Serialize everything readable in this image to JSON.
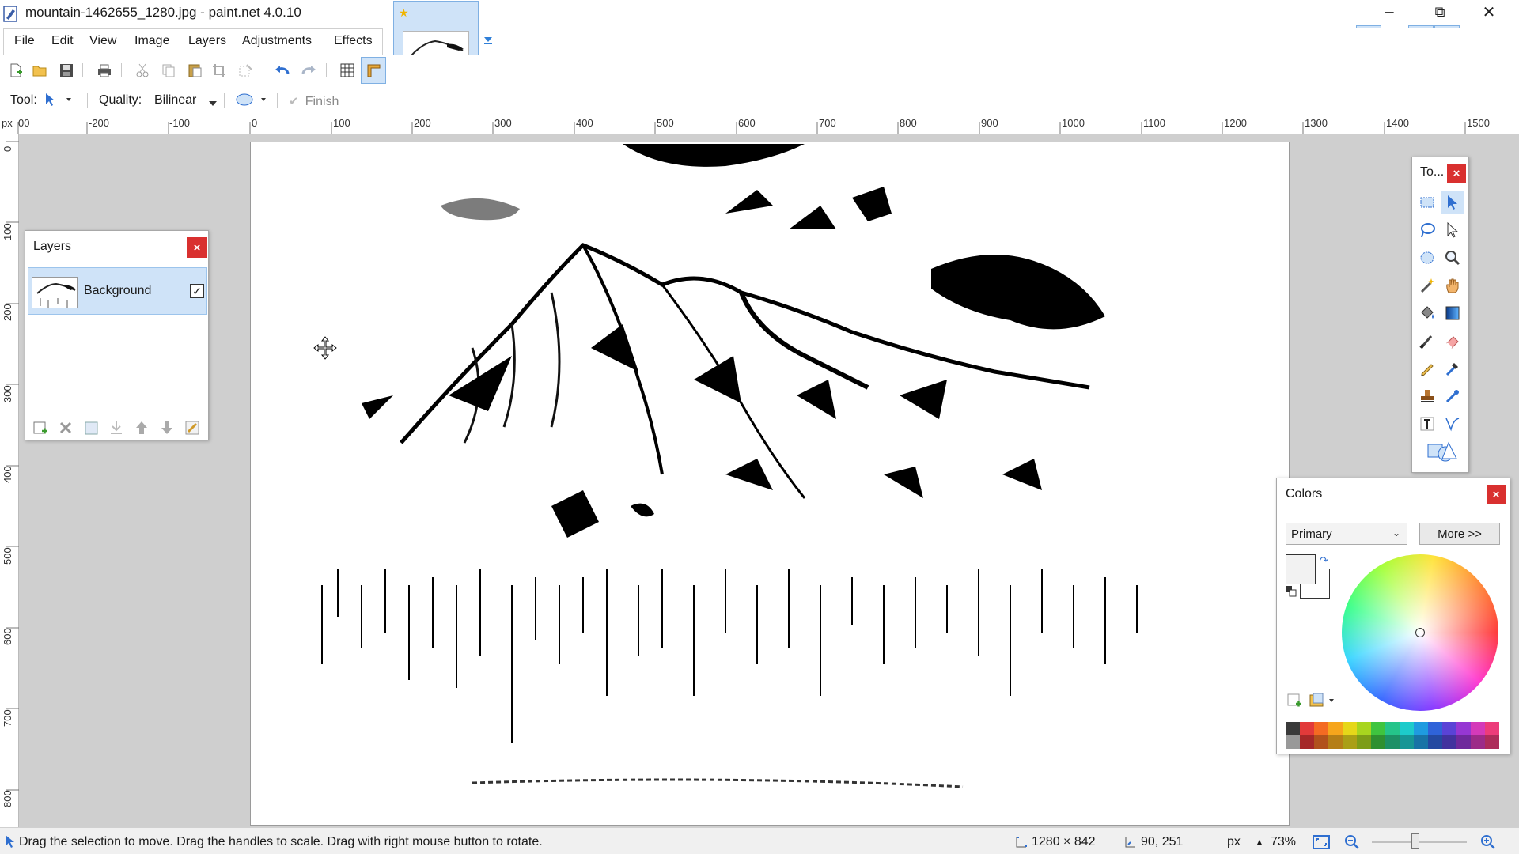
{
  "window": {
    "title": "mountain-1462655_1280.jpg - paint.net 4.0.10",
    "controls": [
      "minimize-icon",
      "restore-icon",
      "close-icon"
    ]
  },
  "menu": {
    "items": [
      "File",
      "Edit",
      "View",
      "Image",
      "Layers",
      "Adjustments",
      "Effects"
    ]
  },
  "toolbar": {
    "buttons": [
      "new-icon",
      "open-icon",
      "save-icon",
      "print-icon",
      "cut-icon",
      "copy-icon",
      "paste-icon",
      "crop-icon",
      "deselect-icon",
      "undo-icon",
      "redo-icon",
      "grid-icon",
      "ruler-icon"
    ]
  },
  "options": {
    "tool_label": "Tool:",
    "quality_label": "Quality:",
    "quality_value": "Bilinear",
    "finish_label": "Finish"
  },
  "ruler": {
    "unit": "px",
    "h_labels": [
      "00",
      "-200",
      "-100",
      "0",
      "100",
      "200",
      "300",
      "400",
      "500",
      "600",
      "700",
      "800",
      "900",
      "1000",
      "1100",
      "1200",
      "1300",
      "1400",
      "1500"
    ],
    "v_labels": [
      "0",
      "100",
      "200",
      "300",
      "400",
      "500",
      "600",
      "700",
      "800"
    ]
  },
  "layers": {
    "title": "Layers",
    "close": "×",
    "items": [
      {
        "name": "Background",
        "visible": true
      }
    ]
  },
  "tools": {
    "title": "To...",
    "close": "×"
  },
  "colors": {
    "title": "Colors",
    "close": "×",
    "mode": "Primary",
    "more_label": "More >>",
    "palette_top": [
      "#3a3a3a",
      "#e23a3a",
      "#f46a22",
      "#f6a51c",
      "#e6d719",
      "#a8d51f",
      "#3fc43f",
      "#25c48a",
      "#1dcbcb",
      "#1f9be0",
      "#2f63d9",
      "#5a43d6",
      "#9637d3",
      "#d43ab9",
      "#ec3c7a"
    ],
    "palette_bottom": [
      "#999999",
      "#a52828",
      "#b1511c",
      "#b57e17",
      "#aa9f16",
      "#7d9d18",
      "#2f9030",
      "#1d9066",
      "#179696",
      "#1873a6",
      "#2449a1",
      "#42329e",
      "#6f299c",
      "#9c2b88",
      "#ad2c5a"
    ]
  },
  "status": {
    "hint": "Drag the selection to move. Drag the handles to scale. Drag with right mouse button to rotate.",
    "image_size": "1280 × 842",
    "cursor_pos": "90, 251",
    "unit": "px",
    "zoom": "73%"
  }
}
